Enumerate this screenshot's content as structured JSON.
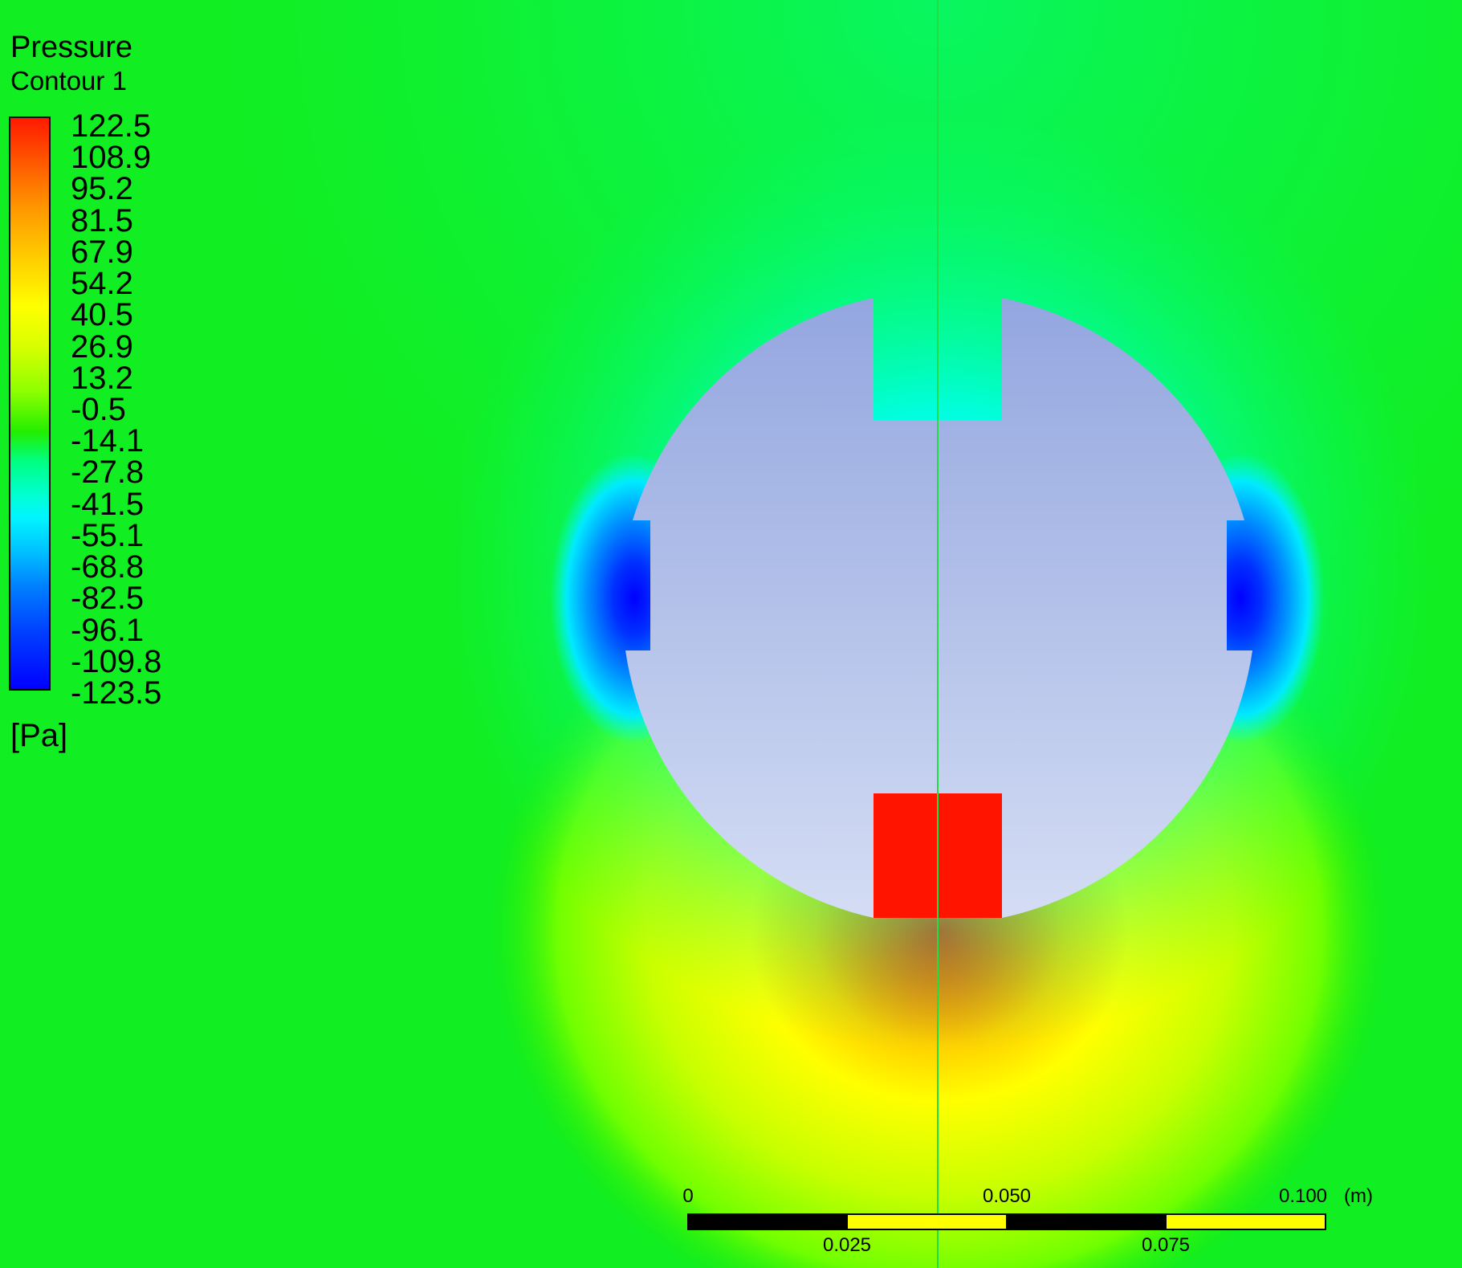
{
  "legend": {
    "title": "Pressure",
    "subtitle": "Contour 1",
    "unit": "[Pa]",
    "ticks": [
      "122.5",
      "108.9",
      "95.2",
      "81.5",
      "67.9",
      "54.2",
      "40.5",
      "26.9",
      "13.2",
      "-0.5",
      "-14.1",
      "-27.8",
      "-41.5",
      "-55.1",
      "-68.8",
      "-82.5",
      "-96.1",
      "-109.8",
      "-123.5"
    ]
  },
  "scale_bar": {
    "label_0": "0",
    "label_025": "0.025",
    "label_050": "0.050",
    "label_075": "0.075",
    "label_100": "0.100",
    "unit": "(m)"
  },
  "colors": {
    "background": "#11ee22",
    "max": "#ff1a00",
    "min": "#0000ff",
    "body": "#a9b8e6"
  }
}
